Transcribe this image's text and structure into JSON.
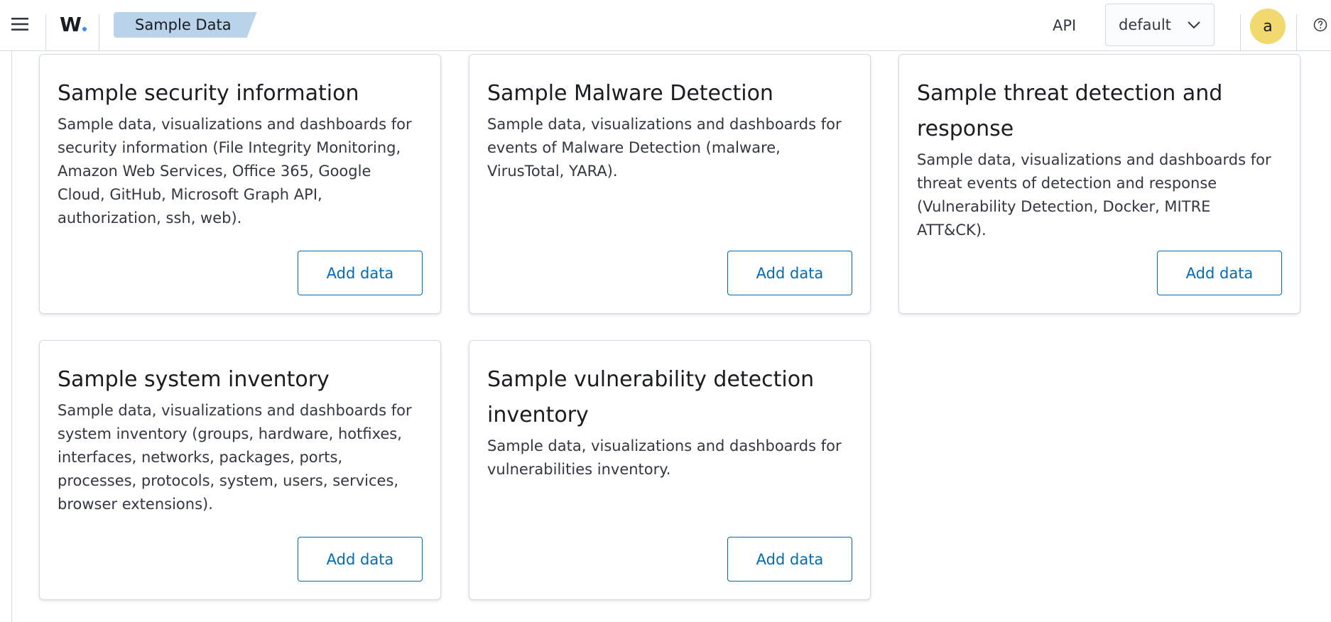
{
  "header": {
    "logo_text": "W",
    "breadcrumb": "Sample Data",
    "api_label": "API",
    "select_value": "default",
    "avatar_initial": "a"
  },
  "colors": {
    "accent": "#006bb4",
    "breadcrumb_bg": "#b8d3ea",
    "avatar_bg": "#f1d86f",
    "logo_dot": "#3d8bf2"
  },
  "icons": {
    "menu": "hamburger-icon",
    "select": "chevron-down-icon",
    "help": "help-circle-icon"
  },
  "cards": [
    {
      "title": "Sample security information",
      "description": "Sample data, visualizations and dashboards for security information (File Integrity Monitoring, Amazon Web Services, Office 365, Google Cloud, GitHub, Microsoft Graph API, authorization, ssh, web).",
      "button": "Add data"
    },
    {
      "title": "Sample Malware Detection",
      "description": "Sample data, visualizations and dashboards for events of Malware Detection (malware, VirusTotal, YARA).",
      "button": "Add data"
    },
    {
      "title": "Sample threat detection and response",
      "description": "Sample data, visualizations and dashboards for threat events of detection and response (Vulnerability Detection, Docker, MITRE ATT&CK).",
      "button": "Add data"
    },
    {
      "title": "Sample system inventory",
      "description": "Sample data, visualizations and dashboards for system inventory (groups, hardware, hotfixes, interfaces, networks, packages, ports, processes, protocols, system, users, services, browser extensions).",
      "button": "Add data"
    },
    {
      "title": "Sample vulnerability detection inventory",
      "description": "Sample data, visualizations and dashboards for vulnerabilities inventory.",
      "button": "Add data"
    }
  ]
}
